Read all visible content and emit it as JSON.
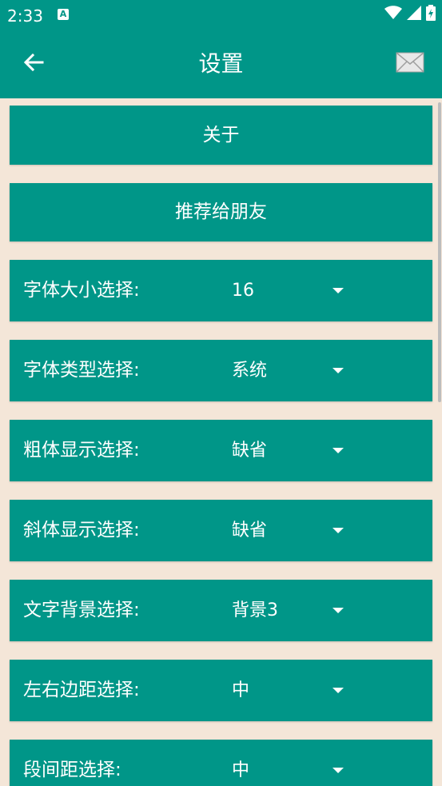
{
  "status_bar": {
    "time": "2:33",
    "notification_icon_letter": "A",
    "icons": [
      "wifi-icon",
      "signal-icon",
      "battery-icon"
    ]
  },
  "app_bar": {
    "title": "设置",
    "back_icon": "arrow-left-icon",
    "mail_icon": "mail-icon"
  },
  "buttons": {
    "about": "关于",
    "recommend": "推荐给朋友"
  },
  "settings": [
    {
      "label": "字体大小选择:",
      "value": "16"
    },
    {
      "label": "字体类型选择:",
      "value": "系统"
    },
    {
      "label": "粗体显示选择:",
      "value": "缺省"
    },
    {
      "label": "斜体显示选择:",
      "value": "缺省"
    },
    {
      "label": "文字背景选择:",
      "value": "背景3"
    },
    {
      "label": "左右边距选择:",
      "value": "中"
    },
    {
      "label": "段间距选择:",
      "value": "中"
    }
  ],
  "colors": {
    "primary": "#009688",
    "background": "#f4e6d8",
    "text": "#ffffff"
  }
}
